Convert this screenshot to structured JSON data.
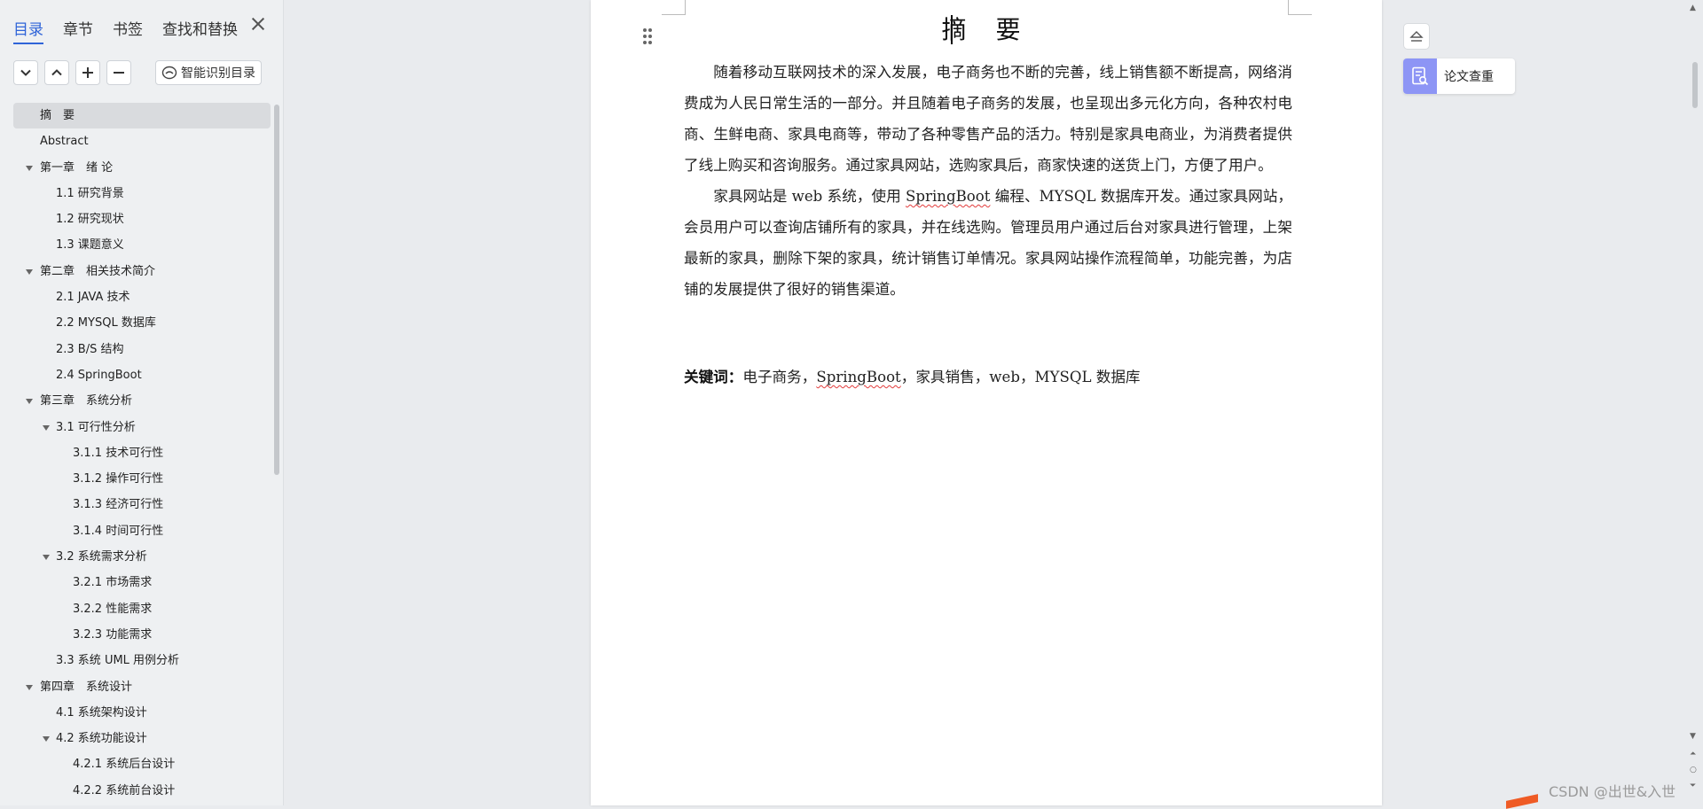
{
  "nav": {
    "tabs": [
      {
        "label": "目录",
        "active": true
      },
      {
        "label": "章节",
        "active": false
      },
      {
        "label": "书签",
        "active": false
      },
      {
        "label": "查找和替换",
        "active": false
      }
    ],
    "smart_toc_label": "智能识别目录",
    "toc": [
      {
        "label": "摘　要",
        "level": 1,
        "expanded": false,
        "selected": true
      },
      {
        "label": "Abstract",
        "level": 1,
        "expanded": false
      },
      {
        "label": "第一章　绪 论",
        "level": 1,
        "expanded": true
      },
      {
        "label": "1.1 研究背景",
        "level": 2,
        "expanded": false
      },
      {
        "label": "1.2 研究现状",
        "level": 2,
        "expanded": false
      },
      {
        "label": "1.3 课题意义",
        "level": 2,
        "expanded": false
      },
      {
        "label": "第二章　相关技术简介",
        "level": 1,
        "expanded": true
      },
      {
        "label": "2.1 JAVA 技术",
        "level": 2,
        "expanded": false
      },
      {
        "label": "2.2 MYSQL 数据库",
        "level": 2,
        "expanded": false
      },
      {
        "label": "2.3 B/S 结构",
        "level": 2,
        "expanded": false
      },
      {
        "label": "2.4 SpringBoot",
        "level": 2,
        "expanded": false
      },
      {
        "label": "第三章　系统分析",
        "level": 1,
        "expanded": true
      },
      {
        "label": "3.1 可行性分析",
        "level": 2,
        "expanded": true
      },
      {
        "label": "3.1.1 技术可行性",
        "level": 3,
        "expanded": false
      },
      {
        "label": "3.1.2 操作可行性",
        "level": 3,
        "expanded": false
      },
      {
        "label": "3.1.3 经济可行性",
        "level": 3,
        "expanded": false
      },
      {
        "label": "3.1.4 时间可行性",
        "level": 3,
        "expanded": false
      },
      {
        "label": "3.2 系统需求分析",
        "level": 2,
        "expanded": true
      },
      {
        "label": "3.2.1 市场需求",
        "level": 3,
        "expanded": false
      },
      {
        "label": "3.2.2 性能需求",
        "level": 3,
        "expanded": false
      },
      {
        "label": "3.2.3 功能需求",
        "level": 3,
        "expanded": false
      },
      {
        "label": "3.3 系统 UML 用例分析",
        "level": 2,
        "expanded": false
      },
      {
        "label": "第四章　系统设计",
        "level": 1,
        "expanded": true
      },
      {
        "label": "4.1 系统架构设计",
        "level": 2,
        "expanded": false
      },
      {
        "label": "4.2 系统功能设计",
        "level": 2,
        "expanded": true
      },
      {
        "label": "4.2.1 系统后台设计",
        "level": 3,
        "expanded": false
      },
      {
        "label": "4.2.2 系统前台设计",
        "level": 3,
        "expanded": false
      }
    ]
  },
  "document": {
    "title": "摘 要",
    "paragraph1": "随着移动互联网技术的深入发展，电子商务也不断的完善，线上销售额不断提高，网络消费成为人民日常生活的一部分。并且随着电子商务的发展，也呈现出多元化方向，各种农村电商、生鲜电商、家具电商等，带动了各种零售产品的活力。特别是家具电商业，为消费者提供了线上购买和咨询服务。通过家具网站，选购家具后，商家快速的送货上门，方便了用户。",
    "paragraph2_a": "家具网站是 web 系统，使用 ",
    "paragraph2_term": "SpringBoot",
    "paragraph2_b": " 编程、MYSQL 数据库开发。通过家具网站，会员用户可以查询店铺所有的家具，并在线选购。管理员用户通过后台对家具进行管理，上架最新的家具，删除下架的家具，统计销售订单情况。家具网站操作流程简单，功能完善，为店铺的发展提供了很好的销售渠道。",
    "keywords_label": "关键词：",
    "keywords_a": "电子商务，",
    "keywords_term": "SpringBoot",
    "keywords_b": "，家具销售，web，MYSQL 数据库"
  },
  "side_panel": {
    "check_label": "论文查重",
    "check_icon_color": "#8d95f5"
  },
  "watermark": "CSDN @出世&入世",
  "colors": {
    "accent": "#2f64d8",
    "spellcheck": "#e23b3b"
  }
}
